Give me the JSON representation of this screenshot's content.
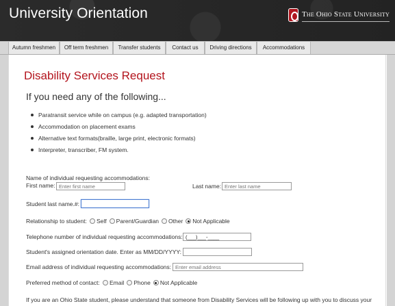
{
  "header": {
    "site_title": "University Orientation",
    "university_name": "The Ohio State University"
  },
  "nav": {
    "items": [
      {
        "label": "Autumn freshmen"
      },
      {
        "label": "Off term freshmen"
      },
      {
        "label": "Transfer students"
      },
      {
        "label": "Contact us"
      },
      {
        "label": "Driving directions"
      },
      {
        "label": "Accommodations"
      }
    ]
  },
  "main": {
    "title": "Disability Services Request",
    "subhead": "If you need any of the following...",
    "bullets": [
      "Paratransit service while on campus (e.g. adapted transportation)",
      "Accommodation on placement exams",
      "Alternative text formats(braille, large print, electronic formats)",
      "Interpreter, transcriber, FM system."
    ]
  },
  "form": {
    "name_section_label": "Name of individual requesting accommodations:",
    "first_name_label": "First name:",
    "first_name_placeholder": "Enter first name",
    "last_name_label": "Last name:",
    "last_name_placeholder": "Enter last name",
    "student_last_name_label": "Student last name.#:",
    "student_last_name_value": "",
    "relationship_label": "Relationship to student:",
    "relationship_options": [
      "Self",
      "Parent/Guardian",
      "Other",
      "Not Applicable"
    ],
    "relationship_selected": "Not Applicable",
    "phone_label": "Telephone number of individual requesting accommodations:",
    "phone_value": "(___)___-____",
    "orientation_date_label": "Student's assigned orientation date. Enter as MM/DD/YYYY:",
    "orientation_date_value": "",
    "email_label": "Email address of individual requesting accommodations:",
    "email_placeholder": "Enter email address",
    "contact_method_label": "Preferred method of contact:",
    "contact_options": [
      "Email",
      "Phone",
      "Not Applicable"
    ],
    "contact_selected": "Not Applicable",
    "footer_text": "If you are an Ohio State student, please understand that someone from Disability Services will be following up with you to discuss your"
  },
  "colors": {
    "title_red": "#b3141d",
    "header_dark": "#2a2a2a",
    "nav_bg": "#d6d6d6"
  }
}
